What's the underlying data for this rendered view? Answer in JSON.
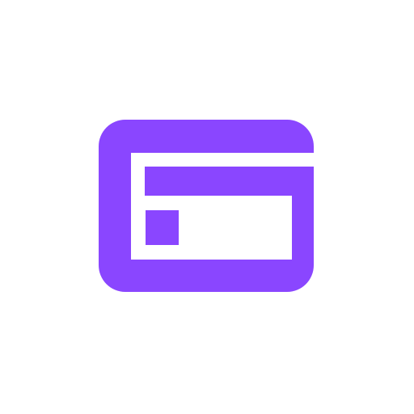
{
  "logo": {
    "name": "purple-card-logo",
    "icon": "credit-card-icon",
    "colors": {
      "background": "#ffffff",
      "brand": "#8A46FF",
      "inner": "#ffffff"
    }
  }
}
